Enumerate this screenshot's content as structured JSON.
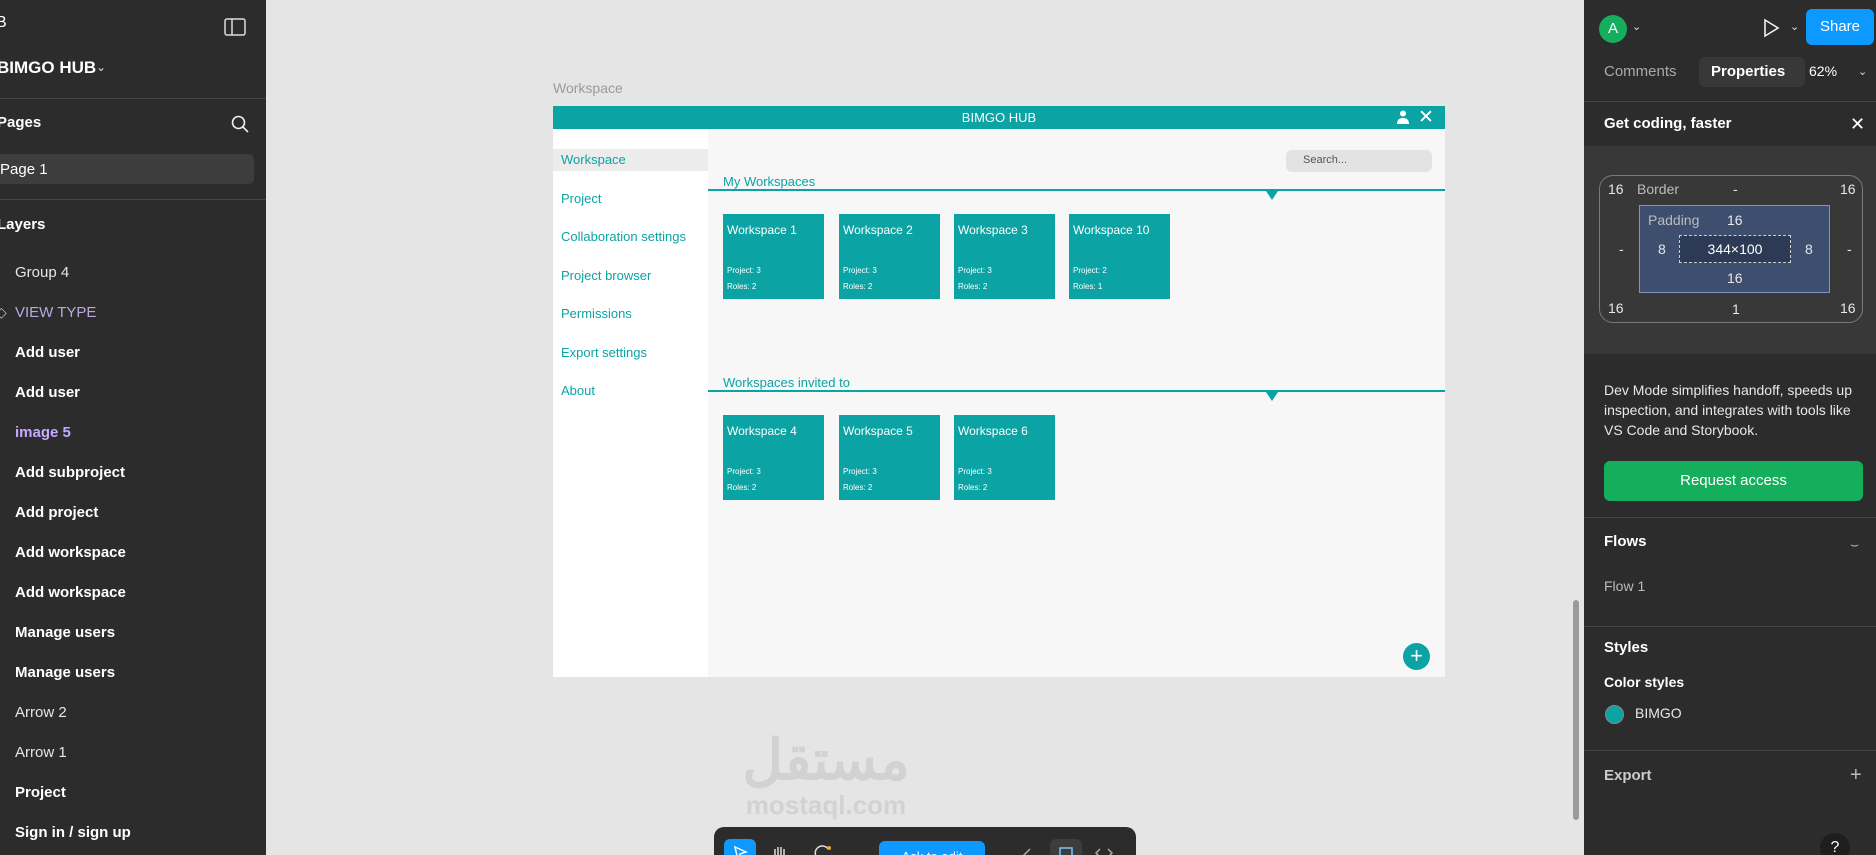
{
  "left_panel": {
    "app_glyph": "B",
    "file_name": "BIMGO HUB",
    "pages_label": "Pages",
    "current_page": "Page 1",
    "layers_label": "Layers",
    "layers": [
      {
        "glyph": "⁞",
        "label": "Group 4"
      },
      {
        "glyph": "◇",
        "label": "VIEW TYPE"
      },
      {
        "glyph": "⁞",
        "label": "Add user"
      },
      {
        "glyph": "⁞",
        "label": "Add user"
      },
      {
        "glyph": "⁞",
        "label": "image 5"
      },
      {
        "glyph": "⁞",
        "label": "Add subproject"
      },
      {
        "glyph": "⁞",
        "label": "Add project"
      },
      {
        "glyph": "⁞",
        "label": "Add workspace"
      },
      {
        "glyph": "⁞",
        "label": "Add workspace"
      },
      {
        "glyph": "⁞",
        "label": "Manage users"
      },
      {
        "glyph": "⁞",
        "label": "Manage users"
      },
      {
        "glyph": "⁞",
        "label": "Arrow 2"
      },
      {
        "glyph": "⁞",
        "label": "Arrow 1"
      },
      {
        "glyph": "⁞",
        "label": "Project"
      },
      {
        "glyph": "⁞",
        "label": "Sign in / sign up"
      }
    ]
  },
  "canvas": {
    "frame_label": "Workspace",
    "app": {
      "title": "BIMGO HUB",
      "close_glyph": "✕",
      "nav": [
        "Workspace",
        "Project",
        "Collaboration settings",
        "Project browser",
        "Permissions",
        "Export settings",
        "About"
      ],
      "search_placeholder": "Search...",
      "my_workspaces_title": "My Workspaces",
      "my_workspaces": [
        {
          "name": "Workspace 1",
          "project": "Project: 3",
          "roles": "Roles: 2"
        },
        {
          "name": "Workspace 2",
          "project": "Project: 3",
          "roles": "Roles: 2"
        },
        {
          "name": "Workspace 3",
          "project": "Project: 3",
          "roles": "Roles: 2"
        },
        {
          "name": "Workspace 10",
          "project": "Project: 2",
          "roles": "Roles: 1"
        }
      ],
      "invited_title": "Workspaces invited to",
      "invited_workspaces": [
        {
          "name": "Workspace 4",
          "project": "Project: 3",
          "roles": "Roles: 2"
        },
        {
          "name": "Workspace 5",
          "project": "Project: 3",
          "roles": "Roles: 2"
        },
        {
          "name": "Workspace 6",
          "project": "Project: 3",
          "roles": "Roles: 2"
        }
      ],
      "fab_glyph": "+"
    },
    "watermark": {
      "line1": "مستقل",
      "line2": "mostaql.com"
    },
    "toolbar": {
      "ask_label": "Ask to edit"
    }
  },
  "right_panel": {
    "avatar_letter": "A",
    "share_label": "Share",
    "tabs": [
      "Comments",
      "Properties"
    ],
    "zoom": "62%",
    "banner_title": "Get coding, faster",
    "box_model": {
      "border_label": "Border",
      "padding_label": "Padding",
      "content_size": "344×100",
      "border_corners": [
        "16",
        "16",
        "16",
        "16"
      ],
      "border_top": "-",
      "border_bottom": "1",
      "border_left": "-",
      "border_right": "-",
      "padding_top": "16",
      "padding_bottom": "16",
      "padding_left": "8",
      "padding_right": "8"
    },
    "promo_text": "Dev Mode simplifies handoff, speeds up inspection, and integrates with tools like VS Code and Storybook.",
    "request_label": "Request access",
    "flows_title": "Flows",
    "flow_item": "Flow 1",
    "styles_title": "Styles",
    "color_styles_title": "Color styles",
    "color_style_name": "BIMGO",
    "export_title": "Export",
    "help_glyph": "?",
    "colors": {
      "accent": "#0ba3a3",
      "share_blue": "#0d99ff",
      "request_green": "#14ae5c"
    }
  }
}
